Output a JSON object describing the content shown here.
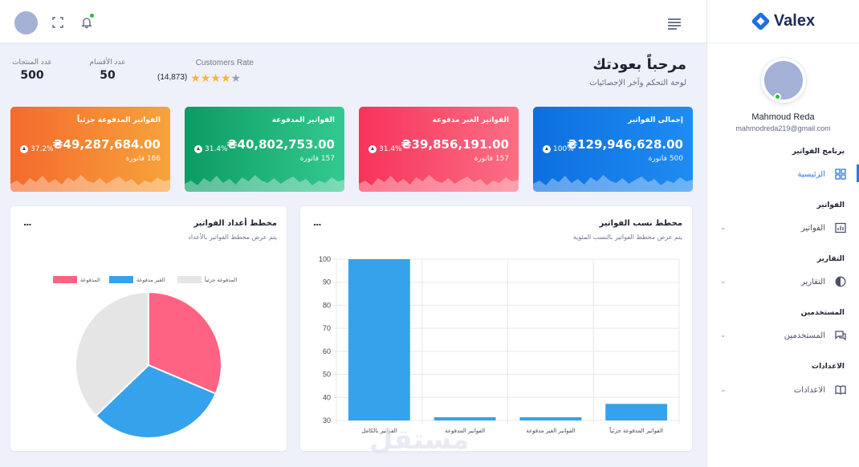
{
  "brand": {
    "name": "Valex"
  },
  "colors": {
    "primary": "#2d7be3",
    "online": "#22c03c",
    "pie_paid": "#ff6384",
    "pie_unpaid": "#36a2eb",
    "pie_partial": "#e5e5e5",
    "bar": "#36a2eb",
    "star": "#f7b731"
  },
  "header": {
    "icons": [
      "avatar",
      "fullscreen-icon",
      "bell-icon",
      "menu-icon"
    ]
  },
  "sidebar": {
    "user": {
      "name": "Mahmoud Reda",
      "email": "mahmodreda219@gmail.com"
    },
    "sections": [
      {
        "title": "برنامج الفواتير",
        "item": "الرئيسية",
        "icon": "dashboard-icon",
        "active": true
      },
      {
        "title": "الفواتير",
        "item": "الفواتير",
        "icon": "invoice-icon",
        "active": false
      },
      {
        "title": "التقارير",
        "item": "التقارير",
        "icon": "pie-icon",
        "active": false
      },
      {
        "title": "المستخدمين",
        "item": "المستخدمين",
        "icon": "chat-icon",
        "active": false
      },
      {
        "title": "الاعدادات",
        "item": "الاعدادات",
        "icon": "book-icon",
        "active": false
      }
    ]
  },
  "welcome": {
    "title": "مرحباً بعودتك",
    "subtitle": "لوحة التحكم وآخر الإحصائيات"
  },
  "stats": [
    {
      "label": "عدد المنتجات",
      "value": "500"
    },
    {
      "label": "عدد الأقسام",
      "value": "50"
    }
  ],
  "customers": {
    "label": "Customers Rate",
    "count": "(14,873)",
    "rating": 4
  },
  "kpis": [
    {
      "title": "إجمالي الفواتير",
      "amount": "₴129,946,628.00",
      "count": "500 فاتورة",
      "percent": "100%",
      "theme": "blue"
    },
    {
      "title": "الفواتير الغير مدفوعة",
      "amount": "₴39,856,191.00",
      "count": "157 فاتورة",
      "percent": "31.4%",
      "theme": "red"
    },
    {
      "title": "الفواتير المدفوعة",
      "amount": "₴40,802,753.00",
      "count": "157 فاتورة",
      "percent": "31.4%",
      "theme": "green"
    },
    {
      "title": "الفواتير المدفوعة جزئياً",
      "amount": "₴49,287,684.00",
      "count": "186 فاتورة",
      "percent": "37.2%",
      "theme": "orange"
    }
  ],
  "bar_panel": {
    "title": "مخطط نسب الفواتير",
    "subtitle": "يتم عرض مخطط الفواتير بالنسب المئوية",
    "menu": "..."
  },
  "pie_panel": {
    "title": "مخطط أعداد الفواتير",
    "subtitle": "يتم عرض مخطط الفواتير بالأعداد",
    "menu": "..."
  },
  "chart_data": [
    {
      "type": "bar",
      "categories": [
        "الفواتير بالكامل",
        "الفواتير المدفوعة",
        "الفواتير الغير مدفوعة",
        "الفواتير المدفوعة جزئياً"
      ],
      "values": [
        100,
        31.4,
        31.4,
        37.2
      ],
      "ylim": [
        30,
        100
      ],
      "yticks": [
        30,
        40,
        50,
        60,
        70,
        80,
        90,
        100
      ],
      "grid": true
    },
    {
      "type": "pie",
      "labels": [
        "المدفوعة",
        "الغير مدفوعة",
        "المدفوعة جزئياً"
      ],
      "values": [
        157,
        157,
        186
      ],
      "legend": "top"
    }
  ],
  "watermark": "مستقل"
}
